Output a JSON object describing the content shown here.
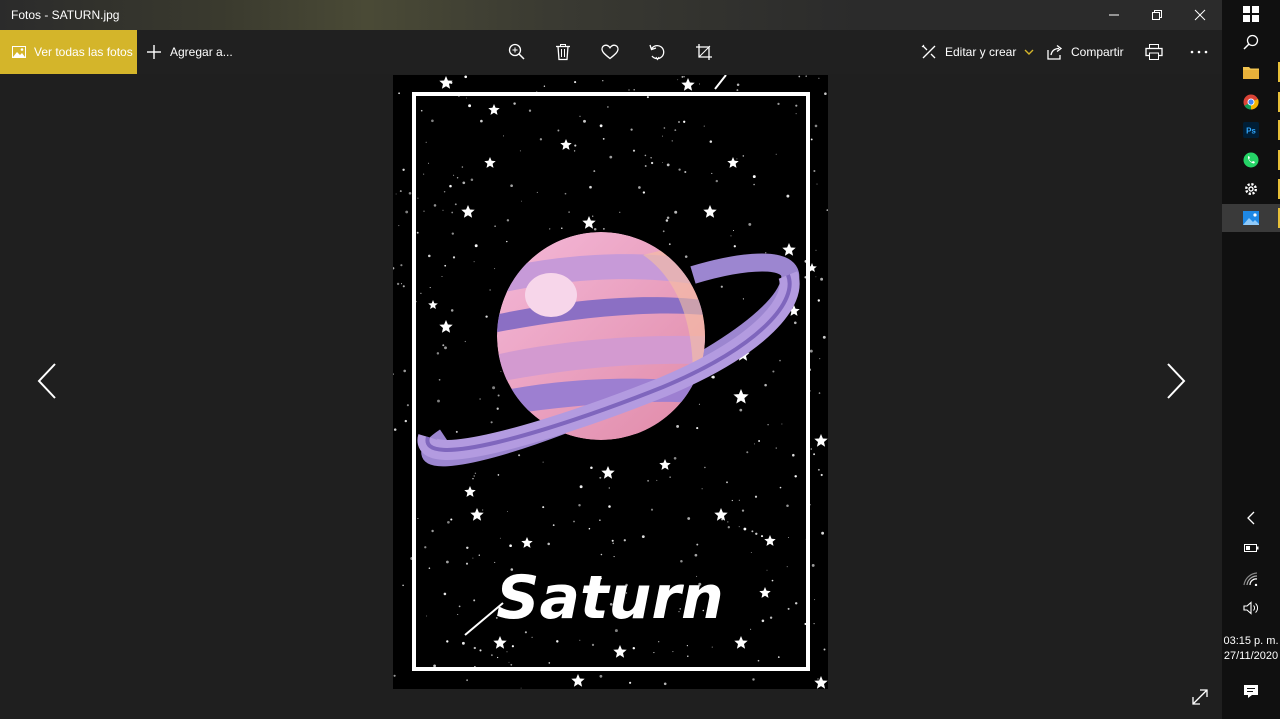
{
  "window": {
    "title": "Fotos - SATURN.jpg"
  },
  "toolbar": {
    "all_photos_label": "Ver todas las fotos",
    "add_label": "Agregar a...",
    "edit_label": "Editar y crear",
    "share_label": "Compartir"
  },
  "photo": {
    "caption": "Saturn"
  },
  "taskbar": {
    "time": "03:15 p. m.",
    "date": "27/11/2020"
  },
  "colors": {
    "accent": "#d4b52a",
    "taskbar_marker": "#e8c13a"
  }
}
